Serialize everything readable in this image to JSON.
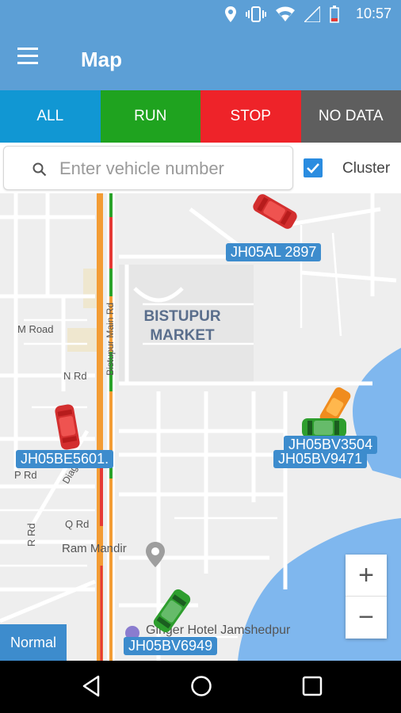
{
  "status_bar": {
    "time": "10:57"
  },
  "app_bar": {
    "title": "Map"
  },
  "tabs": [
    {
      "label": "ALL"
    },
    {
      "label": "RUN"
    },
    {
      "label": "STOP"
    },
    {
      "label": "NO DATA"
    }
  ],
  "search": {
    "placeholder": "Enter vehicle number",
    "value": ""
  },
  "cluster": {
    "label": "Cluster",
    "checked": true
  },
  "map": {
    "streets": {
      "m_road": "M Road",
      "n_rd": "N Rd",
      "p_rd": "P Rd",
      "q_rd": "Q Rd",
      "r_rd": "R Rd",
      "bistupur_main_rd": "Bistupur Main Rd",
      "diagonal": "Diago"
    },
    "district": "BISTUPUR MARKET",
    "pois": {
      "ram_mandir": "Ram Mandir",
      "hotel": "Ginger Hotel Jamshedpur"
    },
    "vehicles": [
      {
        "plate": "JH05AL 2897",
        "status": "stop",
        "color": "#e53935"
      },
      {
        "plate": "JH05BE5601.",
        "status": "stop",
        "color": "#e53935"
      },
      {
        "plate": "JH05BV3504",
        "status": "idle",
        "color": "#f08c1e"
      },
      {
        "plate": "JH05BV9471",
        "status": "run",
        "color": "#2aa32a"
      },
      {
        "plate": "JH05BV6949",
        "status": "run",
        "color": "#2aa32a"
      }
    ],
    "zoom": {
      "in": "+",
      "out": "−"
    },
    "map_type_button": "Normal"
  }
}
